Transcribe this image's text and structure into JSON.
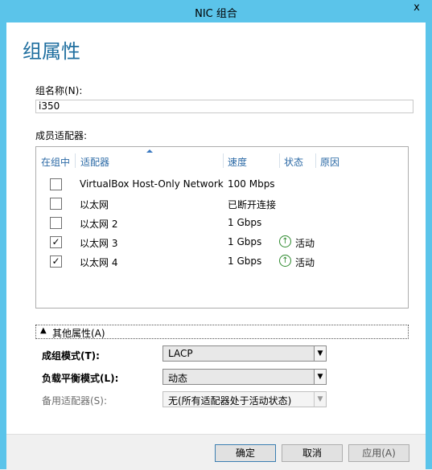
{
  "window": {
    "title": "NIC 组合",
    "close_glyph": "x"
  },
  "page_title": "组属性",
  "group_name": {
    "label": "组名称(N):",
    "value": "i350"
  },
  "members": {
    "label": "成员适配器:",
    "columns": [
      "在组中",
      "适配器",
      "速度",
      "状态",
      "原因"
    ],
    "rows": [
      {
        "checked": false,
        "adapter": "VirtualBox Host-Only Network",
        "speed": "100 Mbps",
        "status": ""
      },
      {
        "checked": false,
        "adapter": "以太网",
        "speed": "已断开连接",
        "status": ""
      },
      {
        "checked": false,
        "adapter": "以太网 2",
        "speed": "1 Gbps",
        "status": ""
      },
      {
        "checked": true,
        "adapter": "以太网 3",
        "speed": "1 Gbps",
        "status": "活动"
      },
      {
        "checked": true,
        "adapter": "以太网 4",
        "speed": "1 Gbps",
        "status": "活动"
      }
    ]
  },
  "more": {
    "expander_label": "其他属性(A)",
    "teaming_mode": {
      "label": "成组模式(T):",
      "value": "LACP"
    },
    "load_balancing": {
      "label": "负载平衡模式(L):",
      "value": "动态"
    },
    "standby": {
      "label": "备用适配器(S):",
      "value": "无(所有适配器处于活动状态)"
    }
  },
  "buttons": {
    "ok": "确定",
    "cancel": "取消",
    "apply": "应用(A)"
  },
  "colors": {
    "title_bar": "#5bc4ea",
    "heading": "#1e6e9f",
    "column_header": "#2c6aa6",
    "active_status": "#2f8a2f"
  }
}
